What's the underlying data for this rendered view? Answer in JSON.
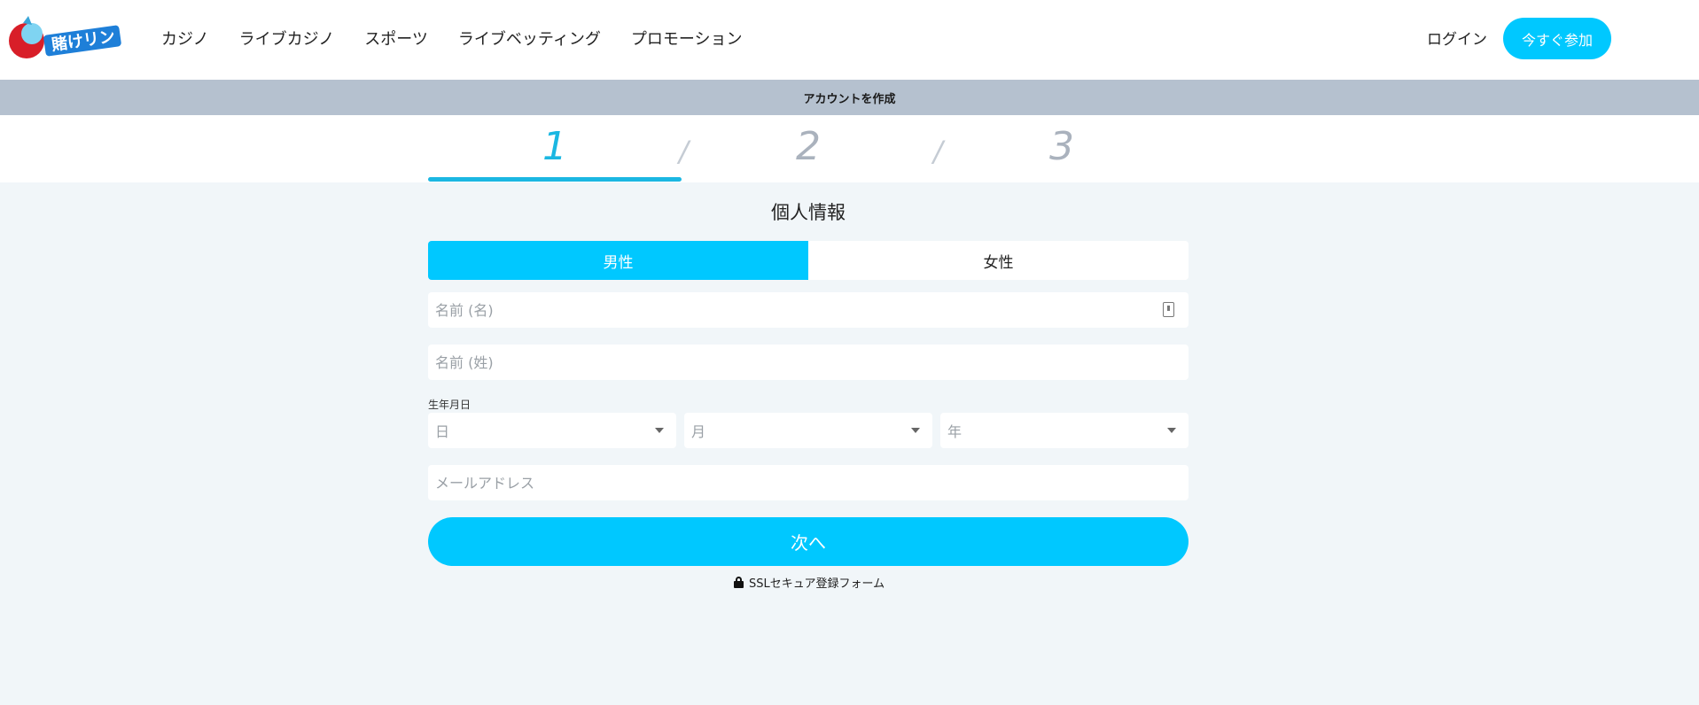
{
  "header": {
    "logo_alt": "賭けリン",
    "nav": [
      "カジノ",
      "ライブカジノ",
      "スポーツ",
      "ライブベッティング",
      "プロモーション"
    ],
    "login": "ログイン",
    "join": "今すぐ参加"
  },
  "titlebar": {
    "text": "アカウントを作成"
  },
  "steps": {
    "items": [
      "1",
      "2",
      "3"
    ],
    "current": 1,
    "separator": "/"
  },
  "form": {
    "title": "個人情報",
    "gender": {
      "male": "男性",
      "female": "女性",
      "selected": "男性"
    },
    "first_name_placeholder": "名前 (名)",
    "last_name_placeholder": "名前 (姓)",
    "dob_label": "生年月日",
    "day_placeholder": "日",
    "month_placeholder": "月",
    "year_placeholder": "年",
    "email_placeholder": "メールアドレス",
    "next": "次へ",
    "secure_text": "SSLセキュア登録フォーム"
  },
  "colors": {
    "accent": "#00c8ff",
    "step_active": "#1bb7e2",
    "titlebar": "#b5c1cf",
    "background": "#f1f6f9"
  }
}
